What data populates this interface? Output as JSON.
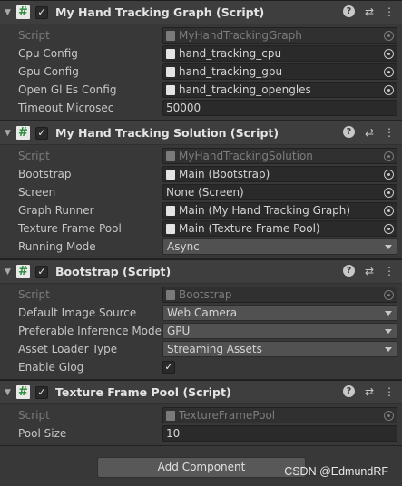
{
  "components": [
    {
      "title": "My Hand Tracking Graph (Script)",
      "fields": [
        {
          "label": "Script",
          "value": "MyHandTrackingGraph",
          "kind": "object",
          "disabled": true
        },
        {
          "label": "Cpu Config",
          "value": "hand_tracking_cpu",
          "kind": "object"
        },
        {
          "label": "Gpu Config",
          "value": "hand_tracking_gpu",
          "kind": "object"
        },
        {
          "label": "Open Gl Es Config",
          "value": "hand_tracking_opengles",
          "kind": "object"
        },
        {
          "label": "Timeout Microsec",
          "value": "50000",
          "kind": "number"
        }
      ]
    },
    {
      "title": "My Hand Tracking Solution (Script)",
      "fields": [
        {
          "label": "Script",
          "value": "MyHandTrackingSolution",
          "kind": "object",
          "disabled": true
        },
        {
          "label": "Bootstrap",
          "value": "Main (Bootstrap)",
          "kind": "object"
        },
        {
          "label": "Screen",
          "value": "None (Screen)",
          "kind": "object-none"
        },
        {
          "label": "Graph Runner",
          "value": "Main (My Hand Tracking Graph)",
          "kind": "object"
        },
        {
          "label": "Texture Frame Pool",
          "value": "Main (Texture Frame Pool)",
          "kind": "object"
        },
        {
          "label": "Running Mode",
          "value": "Async",
          "kind": "dropdown"
        }
      ]
    },
    {
      "title": "Bootstrap (Script)",
      "fields": [
        {
          "label": "Script",
          "value": "Bootstrap",
          "kind": "object",
          "disabled": true
        },
        {
          "label": "Default Image Source",
          "value": "Web Camera",
          "kind": "dropdown"
        },
        {
          "label": "Preferable Inference Mode",
          "value": "GPU",
          "kind": "dropdown"
        },
        {
          "label": "Asset Loader Type",
          "value": "Streaming Assets",
          "kind": "dropdown"
        },
        {
          "label": "Enable Glog",
          "value": "✓",
          "kind": "checkbox"
        }
      ]
    },
    {
      "title": "Texture Frame Pool (Script)",
      "fields": [
        {
          "label": "Script",
          "value": "TextureFramePool",
          "kind": "object",
          "disabled": true
        },
        {
          "label": "Pool Size",
          "value": "10",
          "kind": "number"
        }
      ]
    }
  ],
  "header_icons": {
    "fold": "▼",
    "script": "#",
    "enabled": "✓",
    "help": "?",
    "settings": "⇄",
    "menu": "⋮"
  },
  "add_component_label": "Add Component",
  "watermark": "CSDN @EdmundRF"
}
